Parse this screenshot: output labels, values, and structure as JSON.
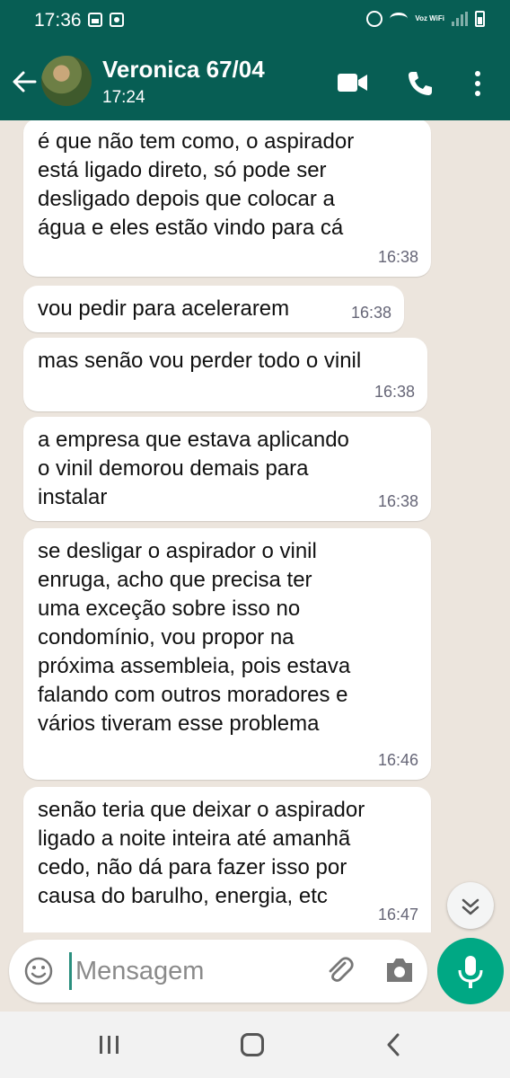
{
  "status_bar": {
    "time": "17:36",
    "network_label": "Voz WiFi",
    "icons": [
      "gallery-icon",
      "screen-record-icon",
      "alarm-icon",
      "wifi-icon",
      "signal-icon",
      "battery-icon"
    ]
  },
  "header": {
    "contact_name": "Veronica 67/04",
    "contact_status": "17:24",
    "icons": [
      "back-arrow-icon",
      "avatar",
      "video-call-icon",
      "phone-call-icon",
      "more-options-icon"
    ]
  },
  "messages": [
    {
      "text": "é que não tem como, o aspirador\nestá ligado direto, só pode ser\ndesligado depois que colocar a\nágua e eles estão vindo para cá",
      "time": "16:38"
    },
    {
      "text": "vou pedir para acelerarem",
      "time": "16:38"
    },
    {
      "text": "mas senão vou perder todo o vinil",
      "time": "16:38"
    },
    {
      "text": "a empresa que estava aplicando\no vinil demorou demais para\ninstalar",
      "time": "16:38"
    },
    {
      "text": "se desligar o aspirador o vinil\nenruga, acho que precisa ter\numa exceção sobre isso no\ncondomínio, vou propor na\npróxima assembleia, pois estava\nfalando com outros moradores e\nvários tiveram esse problema",
      "time": "16:46"
    },
    {
      "text": "senão teria que deixar o aspirador\nligado a noite inteira até amanhã\ncedo, não dá para fazer isso por\ncausa do barulho, energia, etc",
      "time": "16:47"
    }
  ],
  "composer": {
    "placeholder": "Mensagem",
    "value": "",
    "icons": [
      "emoji-icon",
      "attach-icon",
      "camera-icon",
      "mic-icon"
    ]
  },
  "colors": {
    "header": "#075e54",
    "chat_background": "#ece5dd",
    "bubble": "#ffffff",
    "accent": "#00a884"
  }
}
